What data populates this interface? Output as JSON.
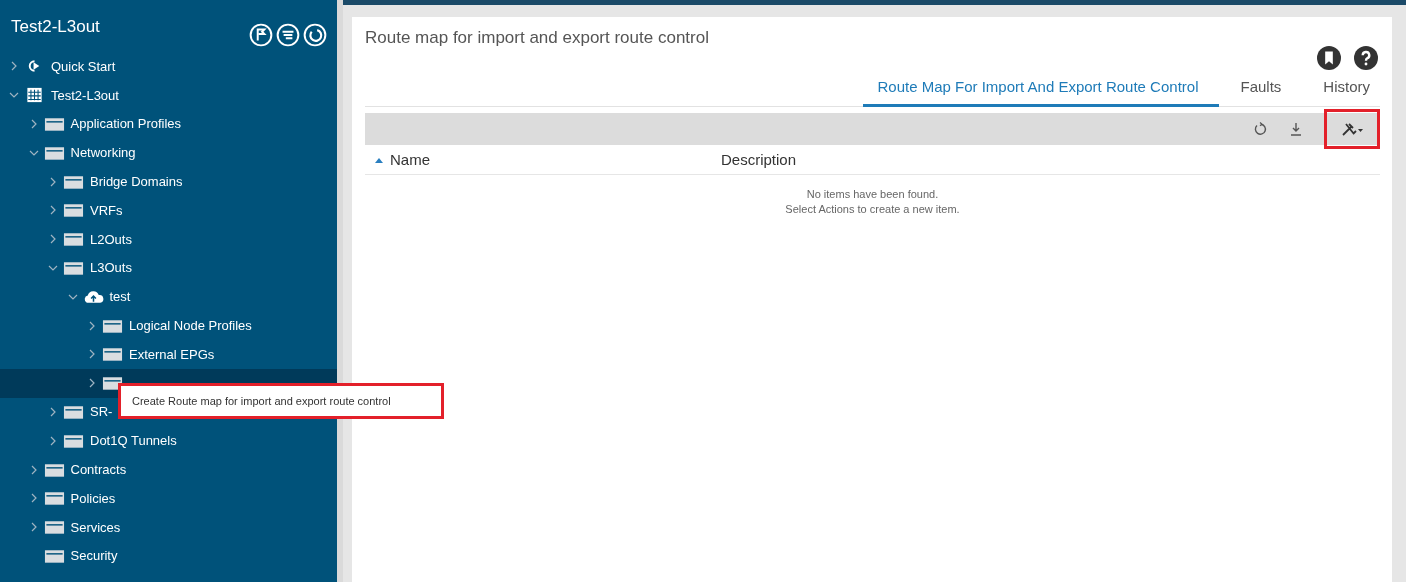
{
  "sidebar": {
    "title": "Test2-L3out",
    "tree": [
      {
        "label": "Quick Start",
        "kind": "start",
        "chevron": true,
        "expanded": false,
        "selected": false
      },
      {
        "label": "Test2-L3out",
        "kind": "tenant",
        "chevron": true,
        "expanded": true,
        "selected": false,
        "children": [
          {
            "label": "Application Profiles",
            "kind": "folder",
            "chevron": true,
            "expanded": false,
            "selected": false
          },
          {
            "label": "Networking",
            "kind": "folder",
            "chevron": true,
            "expanded": true,
            "selected": false,
            "children": [
              {
                "label": "Bridge Domains",
                "kind": "folder",
                "chevron": true,
                "expanded": false,
                "selected": false
              },
              {
                "label": "VRFs",
                "kind": "folder",
                "chevron": true,
                "expanded": false,
                "selected": false
              },
              {
                "label": "L2Outs",
                "kind": "folder",
                "chevron": true,
                "expanded": false,
                "selected": false
              },
              {
                "label": "L3Outs",
                "kind": "folder",
                "chevron": true,
                "expanded": true,
                "selected": false,
                "children": [
                  {
                    "label": "test",
                    "kind": "cloud",
                    "chevron": true,
                    "expanded": true,
                    "selected": false,
                    "children": [
                      {
                        "label": "Logical Node Profiles",
                        "kind": "folder",
                        "chevron": true,
                        "expanded": false,
                        "selected": false
                      },
                      {
                        "label": "External EPGs",
                        "kind": "folder",
                        "chevron": true,
                        "expanded": false,
                        "selected": false
                      },
                      {
                        "kind": "folder",
                        "chevron": true,
                        "expanded": false,
                        "selected": true
                      }
                    ]
                  }
                ]
              },
              {
                "label": "SR-",
                "kind": "folder",
                "chevron": true,
                "expanded": false,
                "selected": false
              },
              {
                "label": "Dot1Q Tunnels",
                "kind": "folder",
                "chevron": true,
                "expanded": false,
                "selected": false
              }
            ]
          },
          {
            "label": "Contracts",
            "kind": "folder",
            "chevron": true,
            "expanded": false,
            "selected": false
          },
          {
            "label": "Policies",
            "kind": "folder",
            "chevron": true,
            "expanded": false,
            "selected": false
          },
          {
            "label": "Services",
            "kind": "folder",
            "chevron": true,
            "expanded": false,
            "selected": false
          },
          {
            "label": "Security",
            "kind": "folder",
            "chevron": false,
            "selected": false
          }
        ]
      }
    ]
  },
  "tooltip": {
    "text": "Create Route map for import and export route control",
    "highlighted": true
  },
  "panel": {
    "title": "Route map for import and export route control",
    "tabs": [
      {
        "label": "Route Map For Import And Export Route Control",
        "selected": true
      },
      {
        "label": "Faults",
        "selected": false
      },
      {
        "label": "History",
        "selected": false
      }
    ],
    "actions_button": {
      "highlighted": true
    },
    "table": {
      "columns": [
        "Name",
        "Description"
      ],
      "empty_message": [
        "No items have been found.",
        "Select Actions to create a new item."
      ]
    }
  }
}
